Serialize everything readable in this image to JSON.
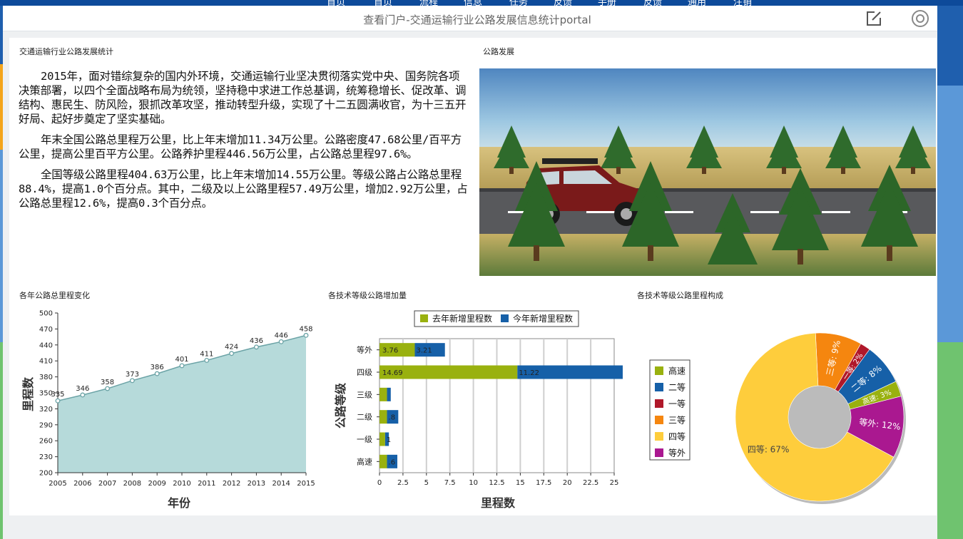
{
  "topnav": [
    "首页",
    "首页",
    "流程",
    "信息",
    "任务",
    "反馈",
    "手册",
    "反馈",
    "通用",
    "注销"
  ],
  "window": {
    "title": "查看门户-交通运输行业公路发展信息统计portal"
  },
  "icons": {
    "edit": "edit-icon",
    "target": "target-icon"
  },
  "stats_panel": {
    "title": "交通运输行业公路发展统计",
    "paragraphs": [
      "2015年，面对错综复杂的国内外环境，交通运输行业坚决贯彻落实党中央、国务院各项决策部署，以四个全面战略布局为统领，坚持稳中求进工作总基调，统筹稳增长、促改革、调结构、惠民生、防风险，狠抓改革攻坚，推动转型升级，实现了十二五圆满收官，为十三五开好局、起好步奠定了坚实基础。",
      "年末全国公路总里程万公里，比上年末增加11.34万公里。公路密度47.68公里/百平方公里，提高公里百平方公里。公路养护里程446.56万公里，占公路总里程97.6%。",
      "全国等级公路里程404.63万公里，比上年末增加14.55万公里。等级公路占公路总里程88.4%，提高1.0个百分点。其中，二级及以上公路里程57.49万公里，增加2.92万公里，占公路总里程12.6%，提高0.3个百分点。"
    ]
  },
  "photo_panel": {
    "title": "公路发展"
  },
  "colors": {
    "area_fill": "#b6dada",
    "area_line": "#6ba3a6",
    "legacy": "#99b10f",
    "current": "#1660a8",
    "gaosu": "#99b10f",
    "erdeng": "#1660a8",
    "yideng": "#b0182a",
    "sandeng": "#f5860f",
    "sideng": "#fecd3c",
    "dengwai": "#aa1890"
  },
  "chart_data": [
    {
      "type": "area",
      "title": "各年公路总里程变化",
      "xlabel": "年份",
      "ylabel": "里程数",
      "x": [
        2005,
        2006,
        2007,
        2008,
        2009,
        2010,
        2011,
        2012,
        2013,
        2014,
        2015
      ],
      "x_ticks": [
        "2005",
        "2006",
        "2007",
        "2008",
        "2009",
        "2010",
        "2011",
        "2012",
        "2013",
        "2014",
        "2015"
      ],
      "values": [
        335,
        346,
        358,
        373,
        386,
        401,
        411,
        424,
        436,
        446,
        458
      ],
      "value_labels": [
        "335",
        "346",
        "358",
        "373",
        "386",
        "401",
        "411",
        "424",
        "436",
        "446",
        "458"
      ],
      "ylim": [
        200,
        500
      ],
      "y_ticks": [
        "200",
        "230",
        "260",
        "290",
        "320",
        "350",
        "380",
        "410",
        "440",
        "470",
        "500"
      ],
      "grid": false
    },
    {
      "type": "bar",
      "orientation": "horizontal",
      "stacked": true,
      "title": "各技术等级公路增加量",
      "xlabel": "里程数",
      "ylabel": "公路等级",
      "categories": [
        "等外",
        "四级",
        "三级",
        "二级",
        "一级",
        "高速"
      ],
      "series": [
        {
          "name": "去年新增里程数",
          "values": [
            3.76,
            14.69,
            0.8,
            0.8,
            0.6,
            0.8
          ]
        },
        {
          "name": "今年新增里程数",
          "values": [
            3.21,
            11.22,
            0.4,
            1.2,
            0.4,
            1.1
          ]
        }
      ],
      "bar_labels": [
        [
          "3.76",
          "3.21"
        ],
        [
          "14.69",
          "11.22"
        ],
        [
          "",
          ""
        ],
        [
          "",
          ".8"
        ],
        [
          "",
          "1"
        ],
        [
          "",
          ".6"
        ]
      ],
      "xlim": [
        0,
        25
      ],
      "x_ticks": [
        "0",
        "2.5",
        "5",
        "7.5",
        "10",
        "12.5",
        "15",
        "17.5",
        "20",
        "22.5",
        "25"
      ],
      "legend": "top",
      "grid": true
    },
    {
      "type": "pie",
      "donut": true,
      "title": "各技术等级公路里程构成",
      "legend": [
        "高速",
        "二等",
        "一等",
        "三等",
        "四等",
        "等外"
      ],
      "slices": [
        {
          "name": "高速",
          "value": 3,
          "label": "高速: 3%"
        },
        {
          "name": "二等",
          "value": 8,
          "label": "二等: 8%"
        },
        {
          "name": "一等",
          "value": 2,
          "label": "一等: 2%"
        },
        {
          "name": "三等",
          "value": 9,
          "label": "三等: 9%"
        },
        {
          "name": "四等",
          "value": 67,
          "label": "四等: 67%"
        },
        {
          "name": "等外",
          "value": 12,
          "label": "等外: 12%"
        }
      ],
      "legend_placement": "left"
    }
  ]
}
